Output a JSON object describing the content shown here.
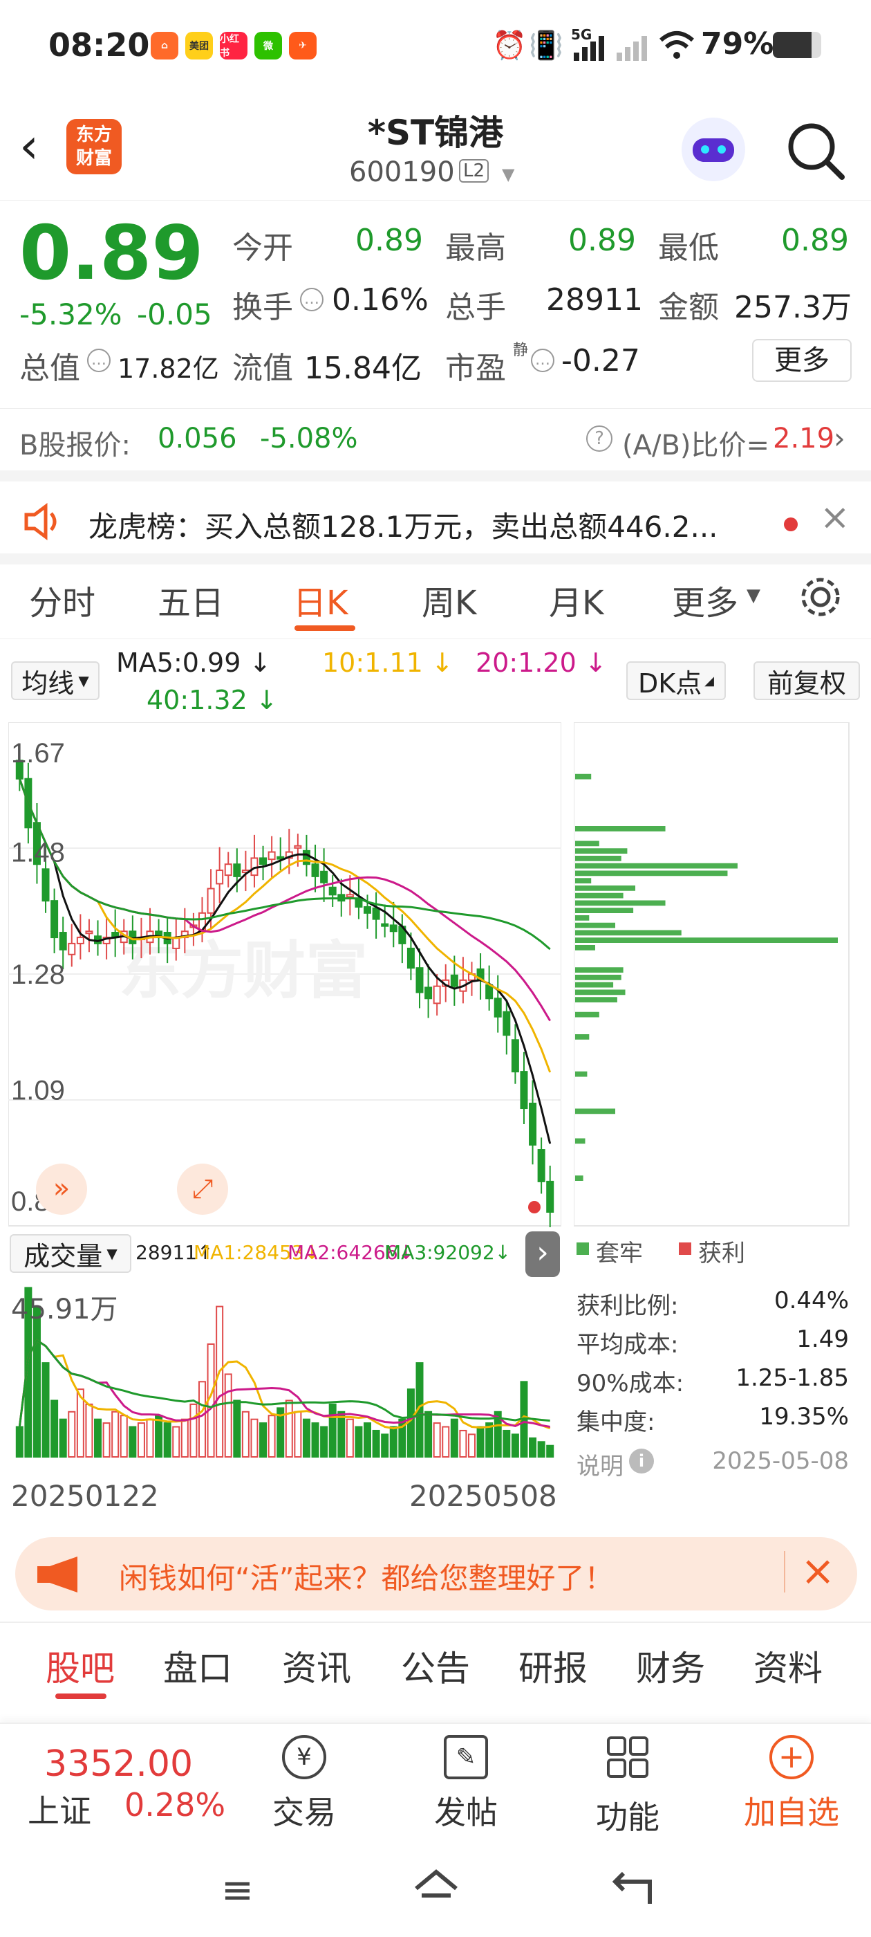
{
  "status": {
    "time": "08:20",
    "network": "5G",
    "battery": "79%",
    "apps": [
      {
        "label": "⌂",
        "color": "#ff6a2a"
      },
      {
        "label": "美团",
        "color": "#ffcf1a"
      },
      {
        "label": "小红书",
        "color": "#ff2442"
      },
      {
        "label": "微",
        "color": "#2dc100"
      },
      {
        "label": "✈",
        "color": "#ff5a1a"
      }
    ]
  },
  "header": {
    "logo_line1": "东方",
    "logo_line2": "财富",
    "title": "*ST锦港",
    "code": "600190",
    "level": "L2"
  },
  "quote": {
    "price": "0.89",
    "change_pct": "-5.32%",
    "change": "-0.05",
    "open_label": "今开",
    "open": "0.89",
    "high_label": "最高",
    "high": "0.89",
    "low_label": "最低",
    "low": "0.89",
    "turnover_label": "换手",
    "turnover": "0.16%",
    "volume_label": "总手",
    "volume": "28911",
    "amount_label": "金额",
    "amount": "257.3万",
    "mcap_label": "总值",
    "mcap": "17.82亿",
    "float_label": "流值",
    "float": "15.84亿",
    "pe_label": "市盈",
    "pe_sup": "静",
    "pe": "-0.27",
    "more": "更多"
  },
  "bshare": {
    "label": "B股报价:",
    "price": "0.056",
    "pct": "-5.08%",
    "ratio_label": "(A/B)比价=",
    "ratio": "2.19"
  },
  "notice": {
    "text": "龙虎榜：买入总额128.1万元，卖出总额446.2..."
  },
  "tabs": [
    "分时",
    "五日",
    "日K",
    "周K",
    "月K",
    "更多"
  ],
  "active_tab": "日K",
  "ma": {
    "selector": "均线",
    "ma5": "MA5:0.99 ↓",
    "ma10": "10:1.11 ↓",
    "ma20": "20:1.20 ↓",
    "ma40": "40:1.32 ↓",
    "dk": "DK点",
    "adjust": "前复权",
    "colors": {
      "ma5": "#111111",
      "ma10": "#f0b400",
      "ma20": "#cc1a8a",
      "ma40": "#1f9a2c"
    }
  },
  "price_axis": [
    "1.67",
    "1.48",
    "1.28",
    "1.09",
    "0.89"
  ],
  "watermark": "东方财富",
  "volume": {
    "selector": "成交量",
    "v": "28911↑",
    "ma1": "MA1:28453↓",
    "ma2": "MA2:64266↓",
    "ma3": "MA3:92092↓",
    "max": "45.91万"
  },
  "dates": {
    "start": "20250122",
    "end": "20250508"
  },
  "chips_panel": {
    "legend_trapped": "套牢",
    "legend_profit": "获利",
    "rows": [
      {
        "k": "获利比例:",
        "v": "0.44%"
      },
      {
        "k": "平均成本:",
        "v": "1.49"
      },
      {
        "k": "90%成本:",
        "v": "1.25-1.85"
      },
      {
        "k": "集中度:",
        "v": "19.35%"
      }
    ],
    "note": "说明",
    "date": "2025-05-08"
  },
  "banner": {
    "text": "闲钱如何“活”起来？都给您整理好了！"
  },
  "bottom_tabs": [
    "股吧",
    "盘口",
    "资讯",
    "公告",
    "研报",
    "财务",
    "资料"
  ],
  "index": {
    "value": "3352.00",
    "name": "上证",
    "pct": "0.28%"
  },
  "nav": {
    "trade": "交易",
    "post": "发帖",
    "func": "功能",
    "watch": "加自选"
  },
  "chart_data": {
    "type": "candlestick",
    "ylim": [
      0.89,
      1.67
    ],
    "y_ticks": [
      1.67,
      1.48,
      1.28,
      1.09,
      0.89
    ],
    "x_start": "20250122",
    "x_end": "20250508",
    "close": [
      1.6,
      1.52,
      1.46,
      1.4,
      1.34,
      1.32,
      1.33,
      1.34,
      1.35,
      1.33,
      1.34,
      1.34,
      1.35,
      1.33,
      1.34,
      1.35,
      1.34,
      1.33,
      1.34,
      1.35,
      1.36,
      1.38,
      1.42,
      1.45,
      1.46,
      1.44,
      1.45,
      1.47,
      1.46,
      1.48,
      1.47,
      1.48,
      1.49,
      1.46,
      1.44,
      1.43,
      1.41,
      1.4,
      1.41,
      1.39,
      1.38,
      1.37,
      1.36,
      1.35,
      1.33,
      1.29,
      1.25,
      1.24,
      1.26,
      1.27,
      1.26,
      1.27,
      1.28,
      1.27,
      1.24,
      1.21,
      1.18,
      1.12,
      1.06,
      1.0,
      0.94,
      0.89
    ],
    "volume_wan": [
      8,
      45,
      40,
      25,
      15,
      10,
      12,
      18,
      14,
      10,
      9,
      12,
      11,
      8,
      9,
      10,
      11,
      9,
      8,
      10,
      14,
      20,
      30,
      40,
      22,
      15,
      12,
      10,
      9,
      11,
      13,
      15,
      12,
      10,
      9,
      8,
      14,
      12,
      10,
      8,
      9,
      7,
      6,
      8,
      10,
      18,
      25,
      12,
      9,
      8,
      10,
      7,
      6,
      8,
      9,
      12,
      7,
      6,
      20,
      5,
      4,
      3
    ]
  }
}
